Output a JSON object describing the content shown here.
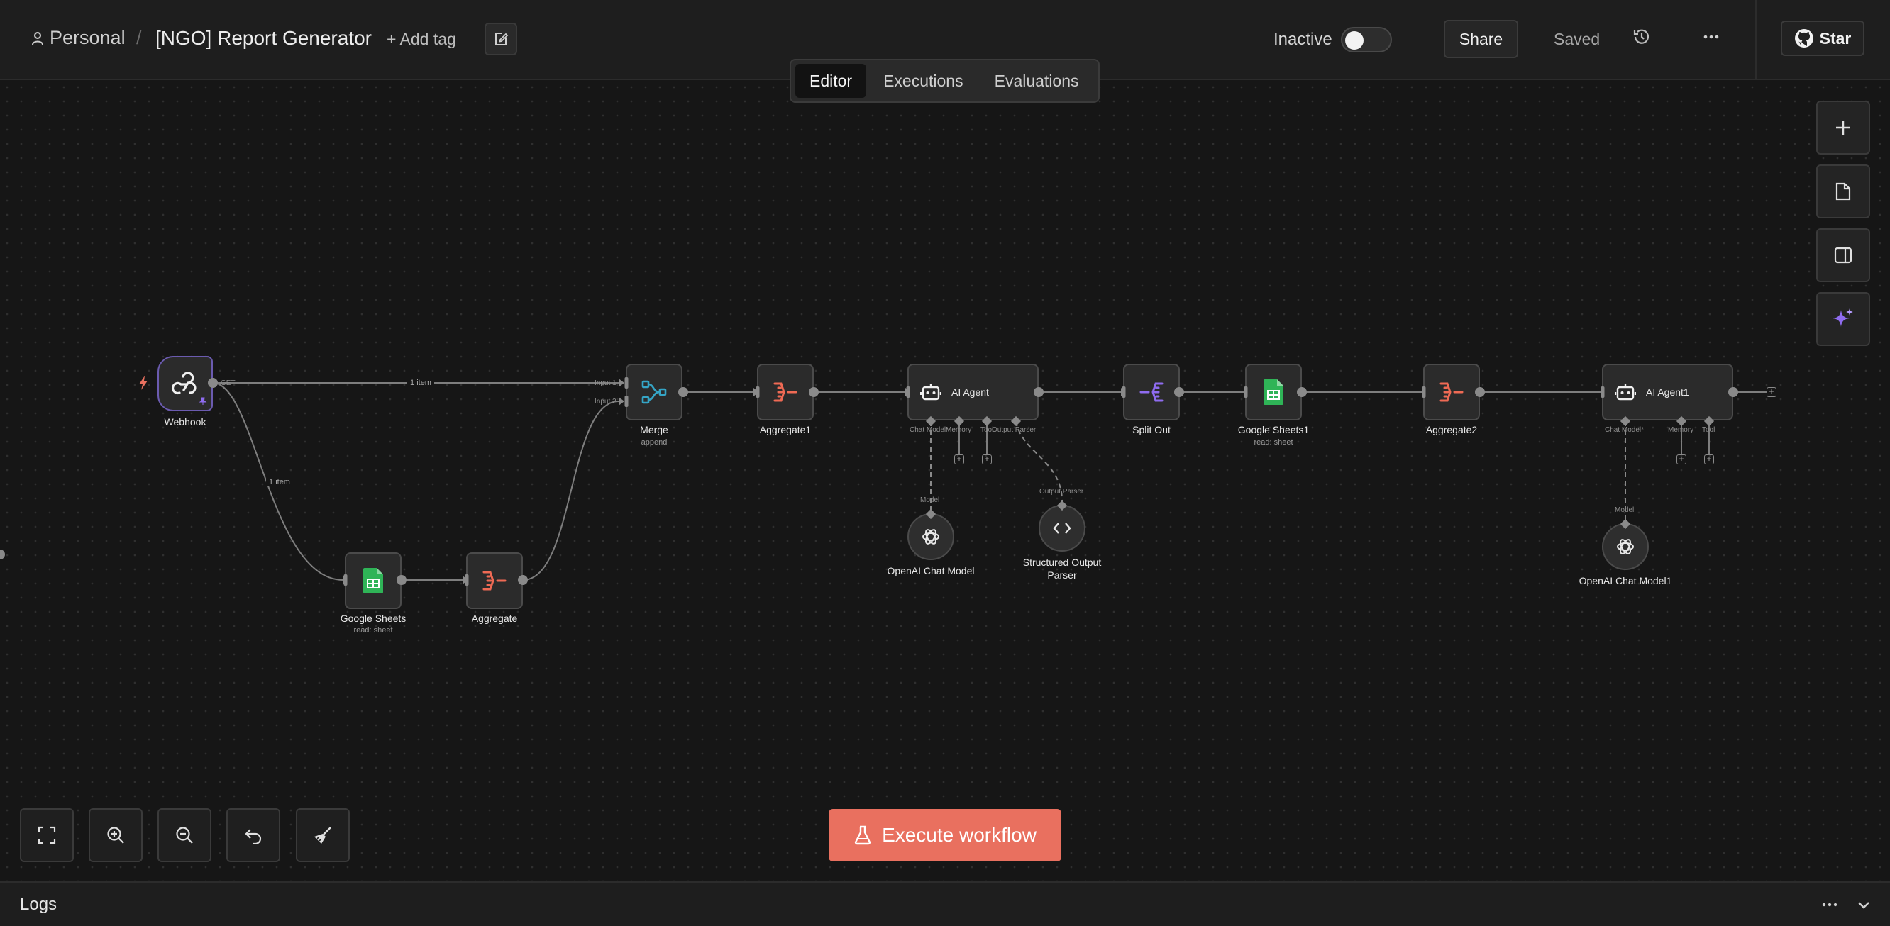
{
  "header": {
    "project": "Personal",
    "separator": "/",
    "workflow_title": "[NGO] Report Generator",
    "add_tag": "+ Add tag",
    "status_label": "Inactive",
    "share_label": "Share",
    "saved_label": "Saved",
    "github_star": "Star"
  },
  "tabs": [
    {
      "label": "Editor",
      "active": true
    },
    {
      "label": "Executions",
      "active": false
    },
    {
      "label": "Evaluations",
      "active": false
    }
  ],
  "nodes": {
    "webhook": {
      "label": "Webhook"
    },
    "google_sheets": {
      "label": "Google Sheets",
      "subtitle": "read: sheet"
    },
    "aggregate": {
      "label": "Aggregate"
    },
    "merge": {
      "label": "Merge",
      "subtitle": "append"
    },
    "aggregate1": {
      "label": "Aggregate1"
    },
    "ai_agent": {
      "label": "AI Agent"
    },
    "openai_chat_model": {
      "label": "OpenAI Chat Model"
    },
    "structured_output_parser": {
      "label": "Structured Output Parser"
    },
    "split_out": {
      "label": "Split Out"
    },
    "google_sheets1": {
      "label": "Google Sheets1",
      "subtitle": "read: sheet"
    },
    "aggregate2": {
      "label": "Aggregate2"
    },
    "ai_agent1": {
      "label": "AI Agent1"
    },
    "openai_chat_model1": {
      "label": "OpenAI Chat Model1"
    }
  },
  "ports": {
    "webhook_out": "GET",
    "merge_input1": "Input 1",
    "merge_input2": "Input 2",
    "agent_chat_model": "Chat Model*",
    "agent_memory": "Memory",
    "agent_tool": "Tool",
    "agent_output_parser": "Output Parser",
    "model_port": "Model",
    "parser_port": "Output Parser",
    "agent1_chat_model": "Chat Model*",
    "agent1_memory": "Memory",
    "agent1_tool": "Tool",
    "model1_port": "Model"
  },
  "edges": {
    "webhook_merge": "1 item",
    "webhook_sheets": "1 item"
  },
  "execute_button": "Execute workflow",
  "logs": {
    "label": "Logs"
  },
  "colors": {
    "accent": "#e9705f",
    "webhook_border": "#6b5bb0",
    "aggregate_icon": "#ef6a54",
    "sheets_icon": "#2fb457",
    "merge_icon": "#35a5c6",
    "split_icon": "#8f6cf0",
    "ai_sparkle": "#8f6cf0"
  }
}
